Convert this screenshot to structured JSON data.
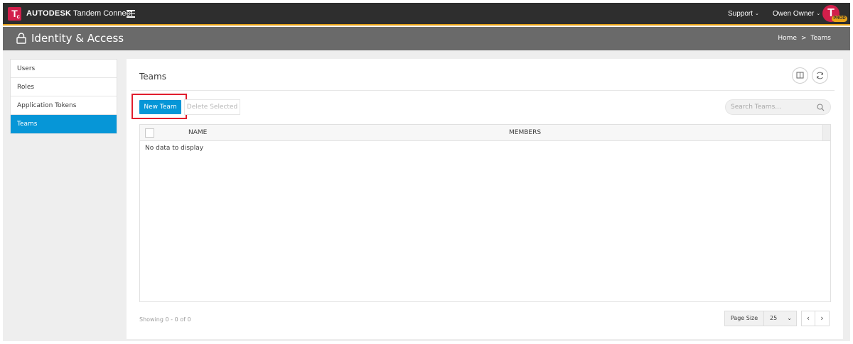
{
  "app": {
    "logo_letter": "T",
    "logo_sub": "c",
    "brand_name": "AUTODESK",
    "product_name": "Tandem Connect",
    "accent_color": "#e8a317",
    "brand_color": "#d21f4b"
  },
  "topbar": {
    "support_label": "Support",
    "user_name": "Owen Owner",
    "avatar_letter": "T",
    "env_badge": "PROD"
  },
  "header": {
    "title": "Identity & Access",
    "breadcrumb": [
      "Home",
      "Teams"
    ],
    "breadcrumb_sep": ">"
  },
  "sidebar": {
    "items": [
      {
        "label": "Users",
        "active": false
      },
      {
        "label": "Roles",
        "active": false
      },
      {
        "label": "Application Tokens",
        "active": false
      },
      {
        "label": "Teams",
        "active": true
      }
    ]
  },
  "panel": {
    "title": "Teams",
    "new_button": "New Team",
    "delete_button": "Delete Selected",
    "search_placeholder": "Search Teams...",
    "columns": [
      "NAME",
      "MEMBERS"
    ],
    "empty_text": "No data to display",
    "showing_text": "Showing 0 - 0 of 0",
    "page_size_label": "Page Size",
    "page_size_value": "25",
    "primary_color": "#0696d7"
  }
}
